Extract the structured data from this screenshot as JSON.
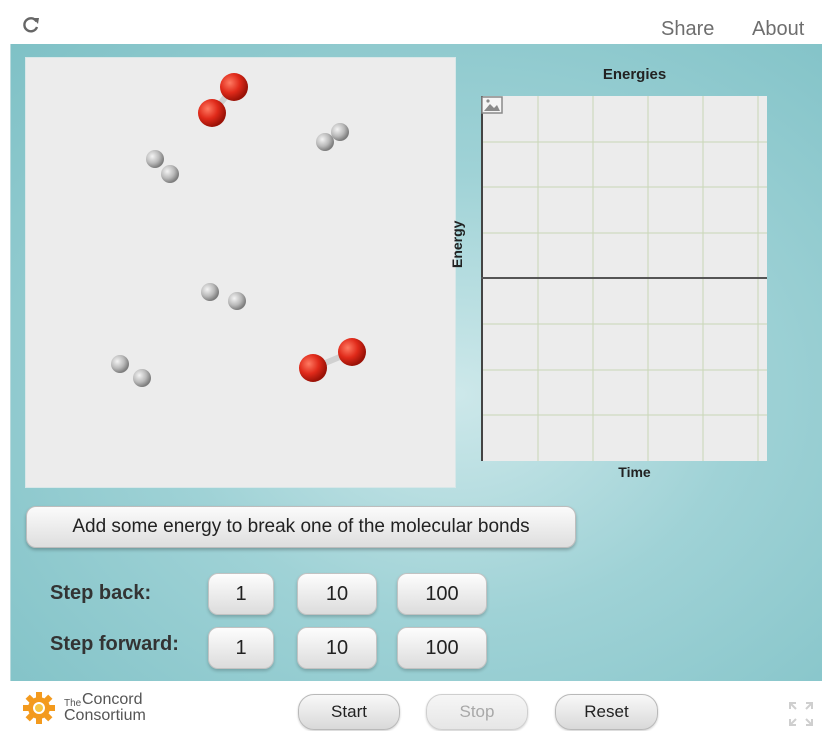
{
  "header": {
    "reload_icon": "reload-icon",
    "share_label": "Share",
    "about_label": "About"
  },
  "graph": {
    "title": "Energies",
    "xlabel": "Time",
    "ylabel": "Energy",
    "legend_icon": "list-icon",
    "image_icon": "image-icon"
  },
  "molecules": {
    "colors": {
      "oxygen": "#e02a1a",
      "hydrogen": "#b9b9b9"
    },
    "items": [
      {
        "type": "O2"
      },
      {
        "type": "H2"
      },
      {
        "type": "H2"
      },
      {
        "type": "H2"
      },
      {
        "type": "H2"
      },
      {
        "type": "O2"
      }
    ]
  },
  "actions": {
    "add_energy_label": "Add some energy to break one of the molecular bonds"
  },
  "steps": {
    "back_label": "Step back:",
    "forward_label": "Step forward:",
    "back_buttons": [
      "1",
      "10",
      "100"
    ],
    "forward_buttons": [
      "1",
      "10",
      "100"
    ]
  },
  "footer": {
    "logo_the": "The",
    "logo_line1": "Concord",
    "logo_line2": "Consortium",
    "start_label": "Start",
    "stop_label": "Stop",
    "reset_label": "Reset",
    "fullscreen_icon": "fullscreen-icon"
  }
}
